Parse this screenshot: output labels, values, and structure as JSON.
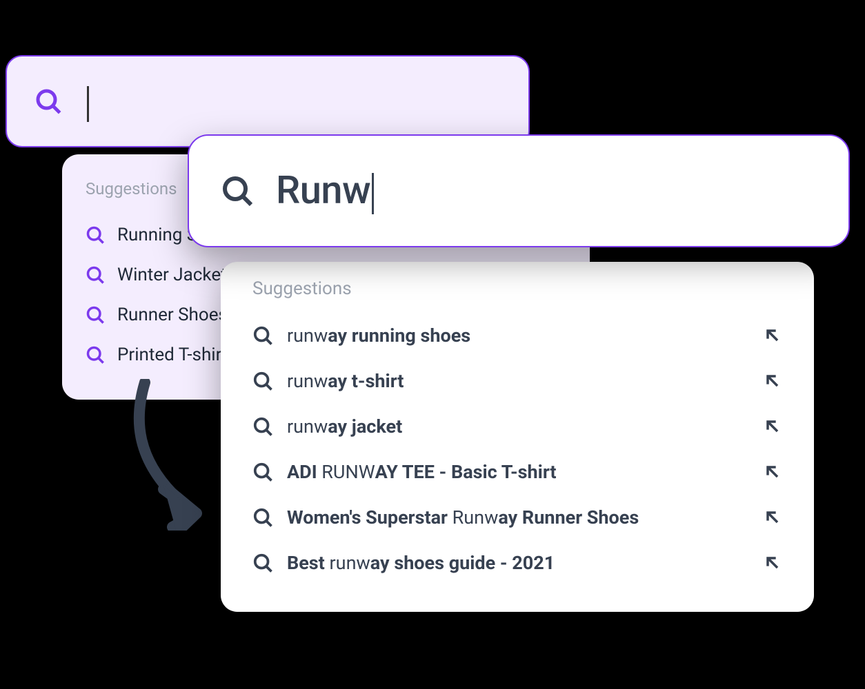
{
  "back": {
    "search_value": "",
    "suggestions_label": "Suggestions",
    "items": [
      {
        "text": "Running Shoes"
      },
      {
        "text": "Winter Jackets"
      },
      {
        "text": "Runner Shoes"
      },
      {
        "text": "Printed T-shirt"
      }
    ]
  },
  "front": {
    "search_value": "Runw",
    "suggestions_label": "Suggestions",
    "items": [
      {
        "segments": [
          {
            "t": "runw",
            "bold": false
          },
          {
            "t": "ay running shoes",
            "bold": true
          }
        ]
      },
      {
        "segments": [
          {
            "t": "runw",
            "bold": false
          },
          {
            "t": "ay t-shirt",
            "bold": true
          }
        ]
      },
      {
        "segments": [
          {
            "t": "runw",
            "bold": false
          },
          {
            "t": "ay jacket",
            "bold": true
          }
        ]
      },
      {
        "segments": [
          {
            "t": "ADI ",
            "bold": true
          },
          {
            "t": "RUNW",
            "bold": false
          },
          {
            "t": "AY TEE - Basic T-shirt",
            "bold": true
          }
        ]
      },
      {
        "segments": [
          {
            "t": "Women's Superstar ",
            "bold": true
          },
          {
            "t": "Runw",
            "bold": false
          },
          {
            "t": "ay Runner Shoes",
            "bold": true
          }
        ]
      },
      {
        "segments": [
          {
            "t": "Best ",
            "bold": true
          },
          {
            "t": "runw",
            "bold": false
          },
          {
            "t": "ay shoes guide - 2021",
            "bold": true
          }
        ]
      }
    ]
  },
  "colors": {
    "accent": "#7c3aed",
    "back_bg": "#f4edfe",
    "text": "#374151",
    "muted": "#9ca3af"
  }
}
